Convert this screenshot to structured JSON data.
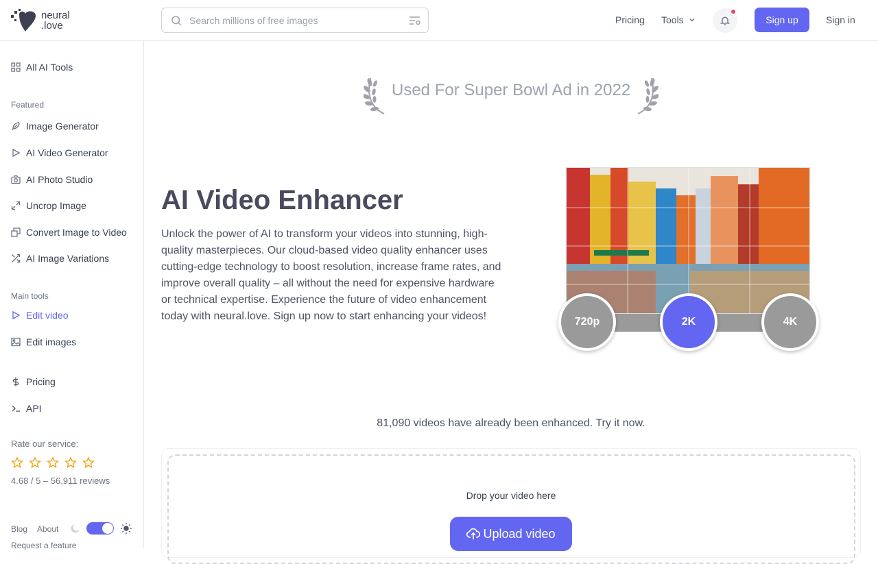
{
  "header": {
    "logo_line1": "neural",
    "logo_line2": ".love",
    "search_placeholder": "Search millions of free images",
    "pricing": "Pricing",
    "tools": "Tools",
    "signup": "Sign up",
    "signin": "Sign in"
  },
  "sidebar": {
    "all_tools": "All AI Tools",
    "featured_title": "Featured",
    "featured": [
      {
        "label": "Image Generator",
        "icon": "feather-icon"
      },
      {
        "label": "AI Video Generator",
        "icon": "play-icon"
      },
      {
        "label": "AI Photo Studio",
        "icon": "camera-icon"
      },
      {
        "label": "Uncrop Image",
        "icon": "expand-icon"
      },
      {
        "label": "Convert Image to Video",
        "icon": "images-icon"
      },
      {
        "label": "AI Image Variations",
        "icon": "shuffle-icon"
      }
    ],
    "main_title": "Main tools",
    "main": [
      {
        "label": "Edit video",
        "icon": "play-icon",
        "active": true
      },
      {
        "label": "Edit images",
        "icon": "image-icon"
      }
    ],
    "pricing": "Pricing",
    "api": "API",
    "rate_label": "Rate our service:",
    "rating": "4.68 / 5 – 56,911 reviews",
    "rating_value": 4.68,
    "blog": "Blog",
    "about": "About",
    "request": "Request a feature",
    "dark_mode": false
  },
  "main": {
    "award": "Used For Super Bowl Ad in 2022",
    "title": "AI Video Enhancer",
    "description": "Unlock the power of AI to transform your videos into stunning, high-quality masterpieces. Our cloud-based video quality enhancer uses cutting-edge technology to boost resolution, increase frame rates, and improve overall quality – all without the need for expensive hardware or technical expertise. Experience the future of video enhancement today with neural.love. Sign up now to start enhancing your videos!",
    "resolutions": [
      "720p",
      "2K",
      "4K"
    ],
    "selected_resolution": "2K",
    "count_text": "81,090 videos have already been enhanced. Try it now.",
    "drop_label": "Drop your video here",
    "upload": "Upload video"
  },
  "colors": {
    "accent": "#6366f1",
    "star": "#f59e0b",
    "notification_dot": "#ef4465",
    "resolution_inactive": "#9a9a9a"
  }
}
